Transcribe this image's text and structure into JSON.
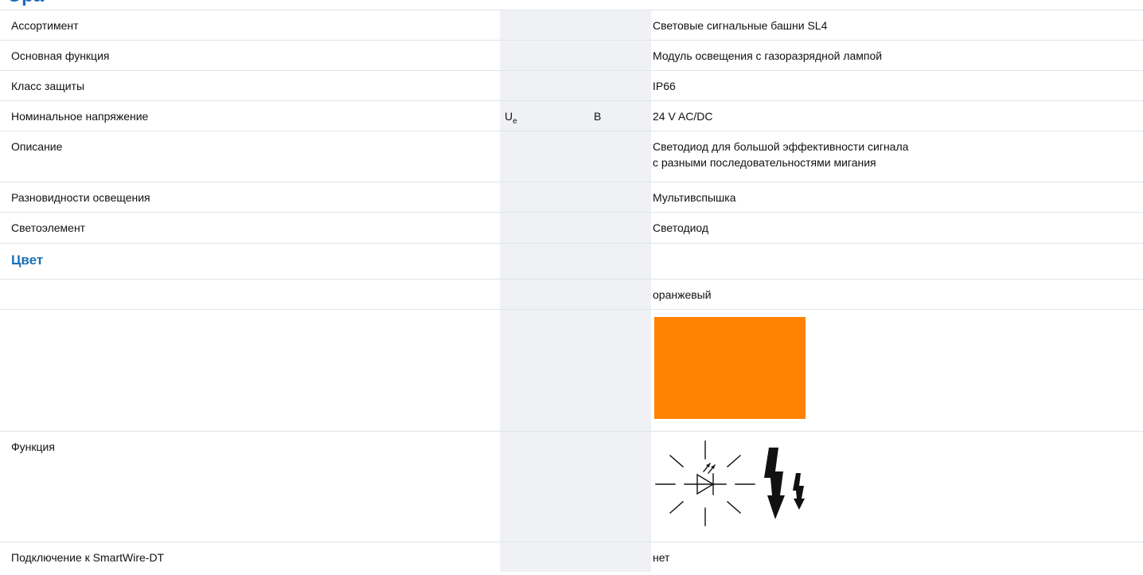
{
  "heading": {
    "text": "Эра"
  },
  "rows": {
    "assortment": {
      "label": "Ассортимент",
      "value": "Световые сигнальные башни SL4"
    },
    "main_function": {
      "label": "Основная функция",
      "value": "Модуль освещения с газоразрядной лампой"
    },
    "protection_class": {
      "label": "Класс защиты",
      "value": "IP66"
    },
    "rated_voltage": {
      "label": "Номинальное напряжение",
      "symbol": "U",
      "symbol_sub": "e",
      "unit": "В",
      "value": "24 V AC/DC"
    },
    "description": {
      "label": "Описание",
      "value_line1": "Светодиод для большой эффективности сигнала",
      "value_line2": "с разными последовательностями мигания"
    },
    "lighting_types": {
      "label": "Разновидности освещения",
      "value": "Мультивспышка"
    },
    "light_element": {
      "label": "Светоэлемент",
      "value": "Светодиод"
    },
    "color_section": {
      "title": "Цвет"
    },
    "color": {
      "value": "оранжевый",
      "swatch_color": "#ff8200"
    },
    "function": {
      "label": "Функция",
      "icon": "flashing-led-multiflash-icon"
    },
    "smartwire": {
      "label": "Подключение к SmartWire-DT",
      "value": "нет"
    }
  }
}
